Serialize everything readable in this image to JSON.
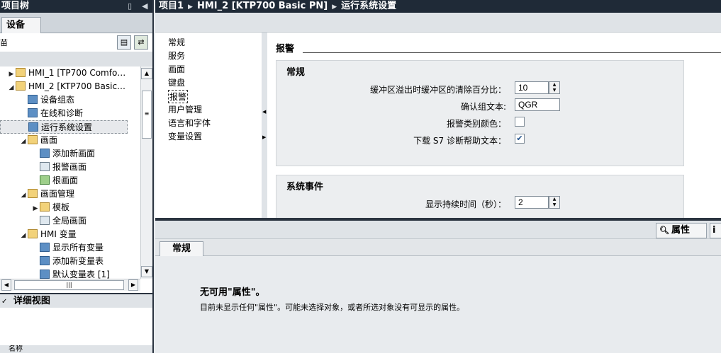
{
  "left_panel": {
    "title": "项目树",
    "tab": "设备",
    "toolbar_partial": "苗",
    "tree": [
      {
        "label": "HMI_1 [TP700 Comfo…",
        "icon": "folder-icon",
        "indent": 0,
        "arrow": "▶"
      },
      {
        "label": "HMI_2 [KTP700 Basic…",
        "icon": "folder-icon",
        "indent": 0,
        "arrow": "◢"
      },
      {
        "label": "设备组态",
        "icon": "device-config-icon",
        "indent": 1,
        "arrow": ""
      },
      {
        "label": "在线和诊断",
        "icon": "diagnostics-icon",
        "indent": 1,
        "arrow": ""
      },
      {
        "label": "运行系统设置",
        "icon": "runtime-settings-icon",
        "indent": 1,
        "arrow": "",
        "selected": true
      },
      {
        "label": "画面",
        "icon": "folder-icon",
        "indent": 1,
        "arrow": "◢"
      },
      {
        "label": "添加新画面",
        "icon": "add-screen-icon",
        "indent": 2,
        "arrow": ""
      },
      {
        "label": "报警画面",
        "icon": "screen-icon",
        "indent": 2,
        "arrow": ""
      },
      {
        "label": "根画面",
        "icon": "root-screen-icon",
        "indent": 2,
        "arrow": ""
      },
      {
        "label": "画面管理",
        "icon": "folder-icon",
        "indent": 1,
        "arrow": "◢"
      },
      {
        "label": "模板",
        "icon": "folder-icon",
        "indent": 2,
        "arrow": "▶"
      },
      {
        "label": "全局画面",
        "icon": "global-screen-icon",
        "indent": 2,
        "arrow": ""
      },
      {
        "label": "HMI 变量",
        "icon": "folder-icon",
        "indent": 1,
        "arrow": "◢"
      },
      {
        "label": "显示所有变量",
        "icon": "show-tags-icon",
        "indent": 2,
        "arrow": ""
      },
      {
        "label": "添加新变量表",
        "icon": "add-tag-table-icon",
        "indent": 2,
        "arrow": ""
      },
      {
        "label": "默认变量表 [1]",
        "icon": "tag-table-icon",
        "indent": 2,
        "arrow": ""
      }
    ],
    "detail_view": {
      "title": "详细视图",
      "column": "名称"
    }
  },
  "breadcrumb": [
    "项目1",
    "HMI_2 [KTP700 Basic PN]",
    "运行系统设置"
  ],
  "nav": {
    "items": [
      "常规",
      "服务",
      "画面",
      "键盘",
      "报警",
      "用户管理",
      "语言和字体",
      "变量设置"
    ],
    "active_index": 4
  },
  "content": {
    "section_title": "报警",
    "general": {
      "title": "常规",
      "buffer_label": "缓冲区溢出时缓冲区的清除百分比：",
      "buffer_value": "10",
      "ack_label": "确认组文本:",
      "ack_value": "QGR",
      "class_color_label": "报警类别颜色：",
      "class_color_checked": false,
      "s7_help_label": "下载 S7 诊断帮助文本：",
      "s7_help_checked": true
    },
    "system_events": {
      "title": "系统事件",
      "duration_label": "显示持续时间（秒）：",
      "duration_value": "2"
    }
  },
  "properties": {
    "tab_properties": "属性",
    "tab_partial": "i",
    "subtab": "常规",
    "no_props_title": "无可用\"属性\"。",
    "no_props_desc": "目前未显示任何\"属性\"。可能未选择对象，或者所选对象没有可显示的属性。"
  }
}
